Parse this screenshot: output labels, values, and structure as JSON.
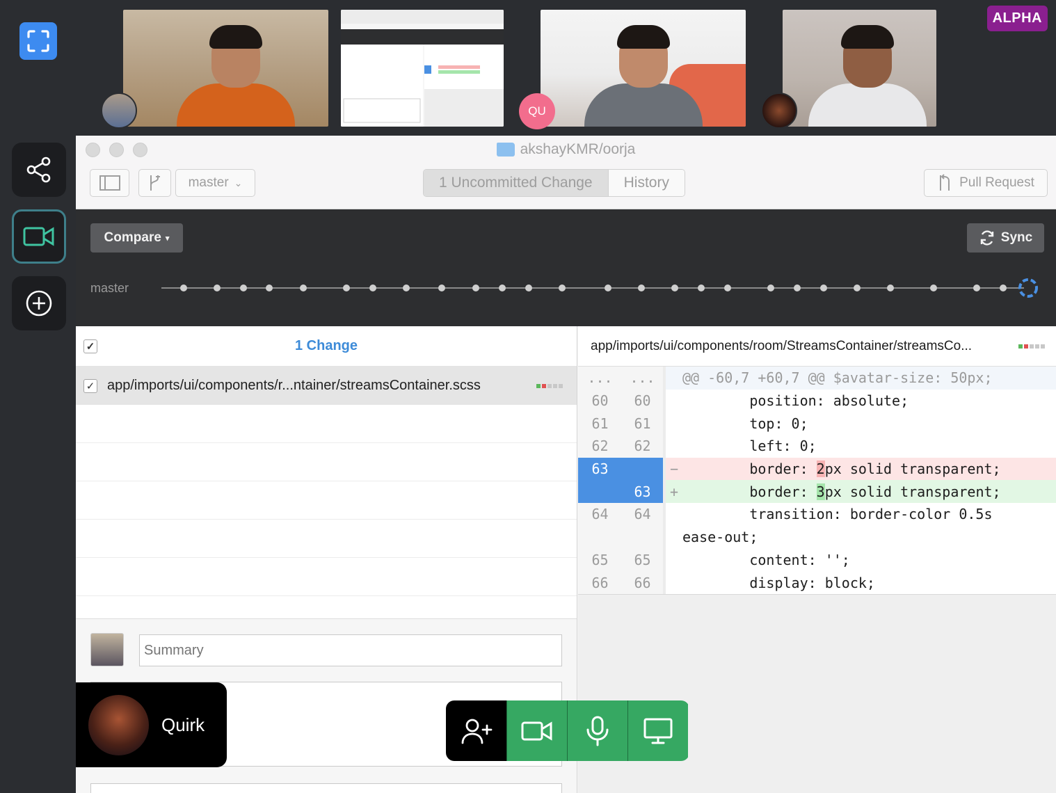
{
  "badge": "ALPHA",
  "participants": [
    {
      "name": "participant-1"
    },
    {
      "name": "screen-share"
    },
    {
      "name": "participant-3",
      "initials": "QU"
    },
    {
      "name": "participant-4"
    }
  ],
  "window": {
    "title": "akshayKMR/oorja",
    "branch": "master",
    "tabs": [
      "1 Uncommitted Change",
      "History"
    ],
    "pull_request": "Pull Request"
  },
  "toolbar": {
    "compare": "Compare",
    "sync": "Sync",
    "branch_label": "master"
  },
  "changes": {
    "header": "1 Change",
    "files": [
      {
        "path": "app/imports/ui/components/r...ntainer/streamsContainer.scss",
        "checked": true
      }
    ]
  },
  "commit": {
    "summary_placeholder": "Summary"
  },
  "diff": {
    "file_path": "app/imports/ui/components/room/StreamsContainer/streamsCo...",
    "hunk": {
      "old": "...",
      "new": "...",
      "code": "@@ -60,7 +60,7 @@ $avatar-size: 50px;"
    },
    "lines": [
      {
        "old": "60",
        "new": "60",
        "mark": "",
        "code": "        position: absolute;",
        "type": "ctx"
      },
      {
        "old": "61",
        "new": "61",
        "mark": "",
        "code": "        top: 0;",
        "type": "ctx"
      },
      {
        "old": "62",
        "new": "62",
        "mark": "",
        "code": "        left: 0;",
        "type": "ctx"
      },
      {
        "old": "63",
        "new": "",
        "mark": "−",
        "pre": "        border: ",
        "hl": "2",
        "post": "px solid transparent;",
        "type": "del"
      },
      {
        "old": "",
        "new": "63",
        "mark": "+",
        "pre": "        border: ",
        "hl": "3",
        "post": "px solid transparent;",
        "type": "add"
      },
      {
        "old": "64",
        "new": "64",
        "mark": "",
        "code": "        transition: border-color 0.5s",
        "type": "ctx"
      },
      {
        "old": "",
        "new": "",
        "mark": "",
        "code": "ease-out;",
        "type": "wrap"
      },
      {
        "old": "65",
        "new": "65",
        "mark": "",
        "code": "        content: '';",
        "type": "ctx"
      },
      {
        "old": "66",
        "new": "66",
        "mark": "",
        "code": "        display: block;",
        "type": "ctx"
      }
    ]
  },
  "caller": {
    "name": "Quirk"
  },
  "colors": {
    "accent": "#3d8bd8",
    "call_green": "#36a862",
    "alpha_purple": "#8a1f8f"
  }
}
